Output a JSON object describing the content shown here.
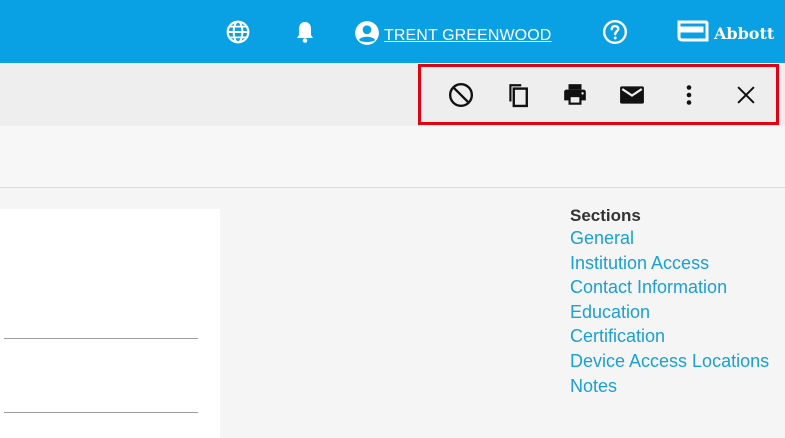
{
  "colors": {
    "header_bg": "#0aa0e4",
    "toolbar_bg": "#eeeeee",
    "highlight_border": "#e3000f",
    "link": "#1a9fd6"
  },
  "header": {
    "icons": [
      "globe-icon",
      "bell-icon",
      "user-circle-icon",
      "help-circle-icon"
    ],
    "user_name": "TRENT GREENWOOD",
    "logo_text": "Abbott"
  },
  "toolbar": {
    "icons": [
      "block-icon",
      "copy-icon",
      "print-icon",
      "email-icon",
      "more-vert-icon",
      "close-icon"
    ]
  },
  "sections": {
    "title": "Sections",
    "items": [
      "General",
      "Institution Access",
      "Contact Information",
      "Education",
      "Certification",
      "Device Access Locations",
      "Notes"
    ]
  }
}
